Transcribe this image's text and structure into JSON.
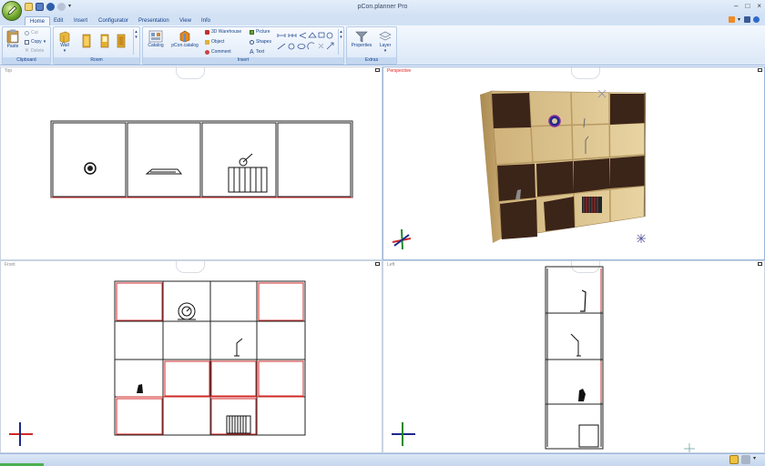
{
  "window": {
    "title": "pCon.planner Pro",
    "min": "–",
    "max": "□",
    "close": "×"
  },
  "tabs": [
    "Home",
    "Edit",
    "Insert",
    "Configurator",
    "Presentation",
    "View",
    "Info"
  ],
  "active_tab": "Home",
  "ribbon": {
    "clipboard": {
      "label": "Clipboard",
      "paste": "Paste",
      "cut": "Cut",
      "copy": "Copy",
      "delete": "Delete"
    },
    "room": {
      "label": "Room",
      "wall": "Wall"
    },
    "insert": {
      "label": "Insert",
      "catalog": "Catalog",
      "pcon_catalog": "pCon.catalog",
      "warehouse": "3D Warehouse",
      "object": "Object",
      "comment": "Comment",
      "picture": "Picture",
      "shapes": "Shapes",
      "text": "Text"
    },
    "extras": {
      "label": "Extras",
      "properties": "Properties",
      "layer": "Layer"
    }
  },
  "viewports": {
    "top": "Top",
    "perspective": "Perspective",
    "front": "Front",
    "left": "Left"
  },
  "colors": {
    "accent": "#15428b",
    "active_view": "#e02020",
    "shelf_wood": "#d9c08a",
    "shelf_dark": "#3b2418",
    "front_red": "#d02828"
  }
}
